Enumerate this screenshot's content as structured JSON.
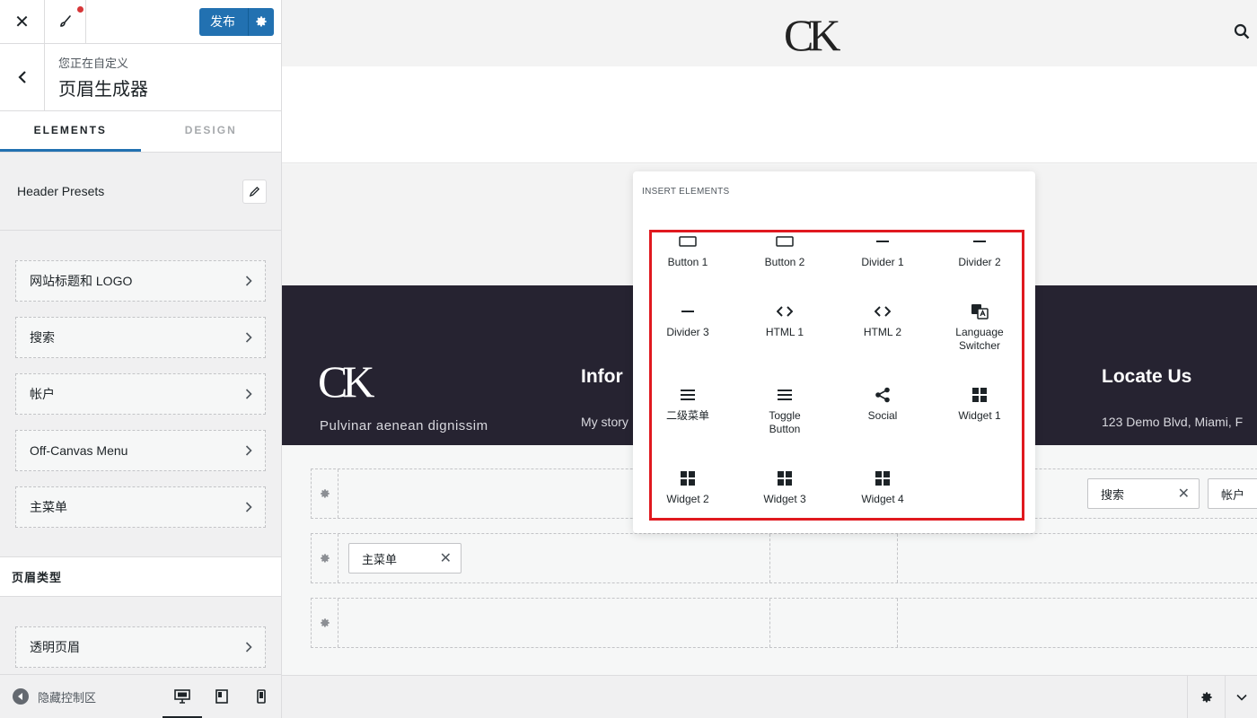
{
  "topbar": {
    "publish_label": "发布"
  },
  "context": {
    "subtitle": "您正在自定义",
    "title": "页眉生成器"
  },
  "tabs": [
    {
      "label": "ELEMENTS",
      "active": true
    },
    {
      "label": "DESIGN",
      "active": false
    }
  ],
  "presets": {
    "label": "Header Presets"
  },
  "elements_list": [
    {
      "label": "网站标题和 LOGO"
    },
    {
      "label": "搜索"
    },
    {
      "label": "帐户"
    },
    {
      "label": "Off-Canvas Menu"
    },
    {
      "label": "主菜单"
    }
  ],
  "header_type": {
    "heading": "页眉类型",
    "item": "透明页眉"
  },
  "footer": {
    "hide_controls": "隐藏控制区"
  },
  "preview": {
    "logo": "CK",
    "footer_logo": "CK",
    "footer_tagline": "Pulvinar aenean dignissim",
    "info_heading": "Infor",
    "info_text": "My story",
    "locate_heading": "Locate Us",
    "address": "123 Demo Blvd, Miami, F"
  },
  "builder": {
    "chips": {
      "search": "搜索",
      "account": "帐户",
      "main_menu": "主菜单"
    }
  },
  "popup": {
    "title": "INSERT ELEMENTS",
    "elements": [
      {
        "label": "Button 1",
        "icon": "button-icon"
      },
      {
        "label": "Button 2",
        "icon": "button-icon"
      },
      {
        "label": "Divider 1",
        "icon": "divider-icon"
      },
      {
        "label": "Divider 2",
        "icon": "divider-icon"
      },
      {
        "label": "Divider 3",
        "icon": "divider-icon"
      },
      {
        "label": "HTML 1",
        "icon": "code-icon"
      },
      {
        "label": "HTML 2",
        "icon": "code-icon"
      },
      {
        "label": "Language Switcher",
        "icon": "translate-icon"
      },
      {
        "label": "二级菜单",
        "icon": "menu-icon"
      },
      {
        "label": "Toggle Button",
        "icon": "menu-icon"
      },
      {
        "label": "Social",
        "icon": "share-icon"
      },
      {
        "label": "Widget 1",
        "icon": "widget-icon"
      },
      {
        "label": "Widget 2",
        "icon": "widget-icon"
      },
      {
        "label": "Widget 3",
        "icon": "widget-icon"
      },
      {
        "label": "Widget 4",
        "icon": "widget-icon"
      }
    ]
  },
  "colors": {
    "accent": "#2271b1",
    "highlight_box": "#e0191f",
    "footer_dark": "#262331",
    "notification_dot": "#d63638"
  }
}
